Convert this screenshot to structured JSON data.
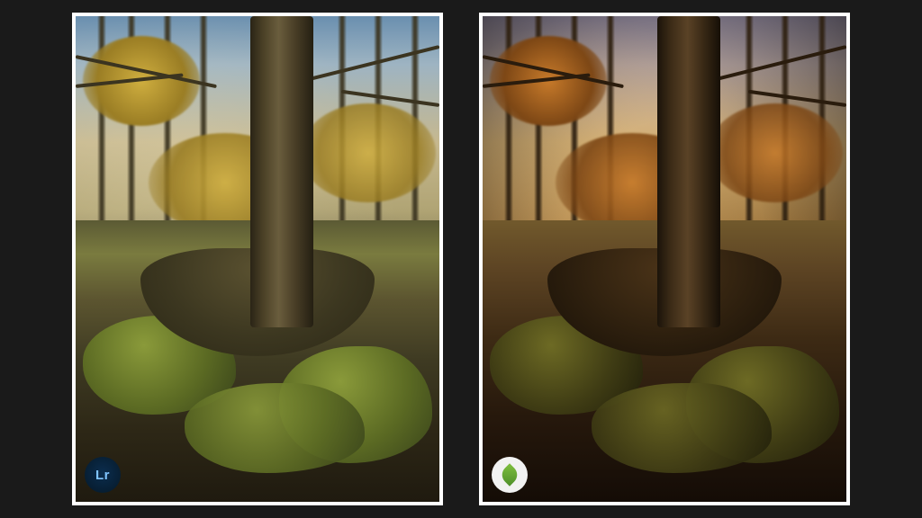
{
  "comparison": {
    "left": {
      "app": "Lightroom",
      "badge_text": "Lr",
      "badge_color": "#0b2d4e",
      "icon": "lightroom-icon"
    },
    "right": {
      "app": "Snapseed",
      "badge_text": "",
      "badge_color": "#f2f2f2",
      "icon": "snapseed-leaf-icon",
      "leaf_color": "#7fbf3f"
    }
  },
  "subject": "Forest tree with mossy roots, autumn woodland",
  "frame_border": "#ffffff",
  "background": "#1a1a1a"
}
